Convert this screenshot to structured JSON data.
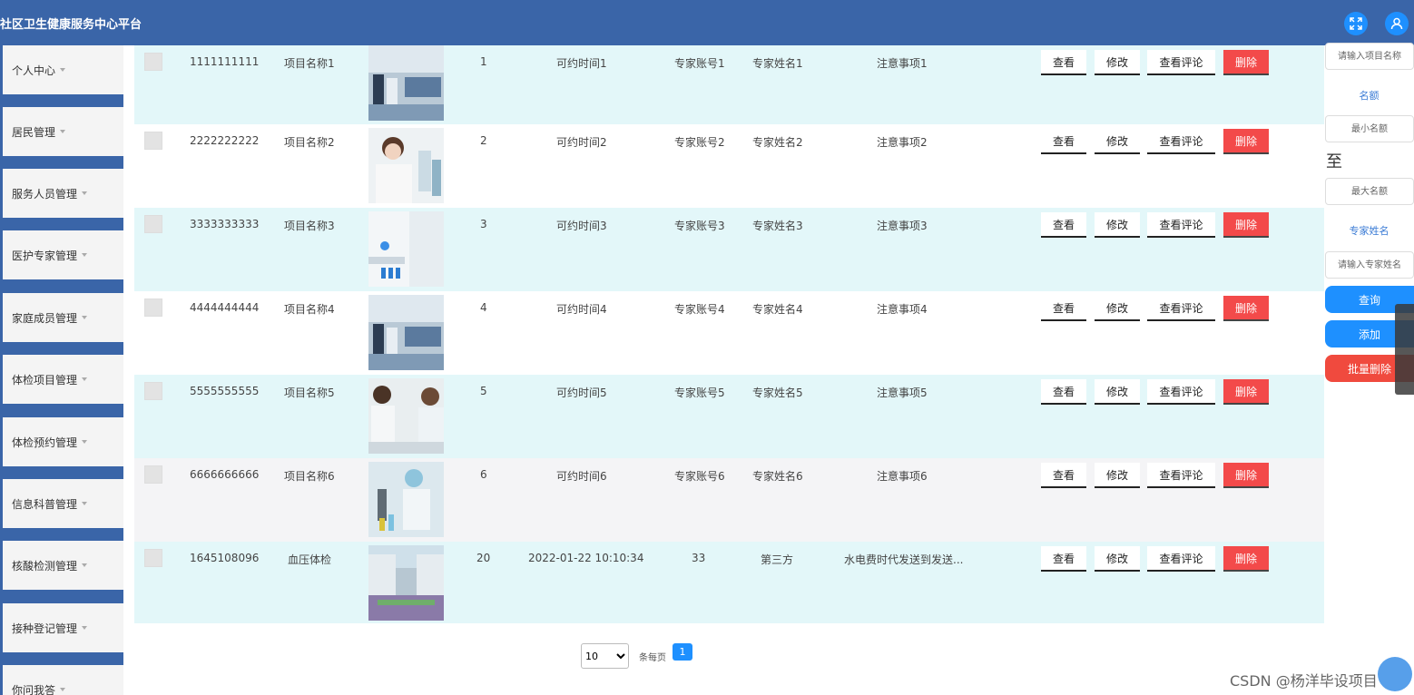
{
  "header": {
    "title": "社区卫生健康服务中心平台",
    "icons": [
      "fullscreen-icon",
      "user-icon"
    ]
  },
  "sidebar": {
    "items": [
      {
        "label": "个人中心"
      },
      {
        "label": "居民管理"
      },
      {
        "label": "服务人员管理"
      },
      {
        "label": "医护专家管理"
      },
      {
        "label": "家庭成员管理"
      },
      {
        "label": "体检项目管理"
      },
      {
        "label": "体检预约管理"
      },
      {
        "label": "信息科普管理"
      },
      {
        "label": "核酸检测管理"
      },
      {
        "label": "接种登记管理"
      },
      {
        "label": "你问我答"
      }
    ]
  },
  "table": {
    "rows": [
      {
        "id": "1111111111",
        "name": "项目名称1",
        "quota": "1",
        "time": "可约时间1",
        "account": "专家账号1",
        "expert": "专家姓名1",
        "notes": "注意事项1"
      },
      {
        "id": "2222222222",
        "name": "项目名称2",
        "quota": "2",
        "time": "可约时间2",
        "account": "专家账号2",
        "expert": "专家姓名2",
        "notes": "注意事项2"
      },
      {
        "id": "3333333333",
        "name": "项目名称3",
        "quota": "3",
        "time": "可约时间3",
        "account": "专家账号3",
        "expert": "专家姓名3",
        "notes": "注意事项3"
      },
      {
        "id": "4444444444",
        "name": "项目名称4",
        "quota": "4",
        "time": "可约时间4",
        "account": "专家账号4",
        "expert": "专家姓名4",
        "notes": "注意事项4"
      },
      {
        "id": "5555555555",
        "name": "项目名称5",
        "quota": "5",
        "time": "可约时间5",
        "account": "专家账号5",
        "expert": "专家姓名5",
        "notes": "注意事项5"
      },
      {
        "id": "6666666666",
        "name": "项目名称6",
        "quota": "6",
        "time": "可约时间6",
        "account": "专家账号6",
        "expert": "专家姓名6",
        "notes": "注意事项6"
      },
      {
        "id": "1645108096",
        "name": "血压体检",
        "quota": "20",
        "time": "2022-01-22 10:10:34",
        "account": "33",
        "expert": "第三方",
        "notes": "水电费时代发送到发送..."
      }
    ],
    "actions": {
      "view": "查看",
      "edit": "修改",
      "reviews": "查看评论",
      "delete": "删除"
    }
  },
  "filters": {
    "project_placeholder": "请输入项目名称",
    "quota_label": "名额",
    "min_placeholder": "最小名额",
    "to_label": "至",
    "max_placeholder": "最大名额",
    "expert_label": "专家姓名",
    "expert_placeholder": "请输入专家姓名",
    "search_button": "查询",
    "add_button": "添加",
    "batch_delete_button": "批量删除"
  },
  "pagination": {
    "page_size": "10",
    "page_size_options": [
      "10"
    ],
    "per_page_label": "条每页",
    "current_page": "1"
  },
  "watermark": "CSDN @杨洋毕设项目",
  "colors": {
    "header": "#3a65a8",
    "row_alt": "#e3f7f9",
    "row_gray": "#f4f4f6",
    "delete": "#f34a4a",
    "primary": "#1e90ff",
    "danger_btn": "#f04a3e"
  }
}
